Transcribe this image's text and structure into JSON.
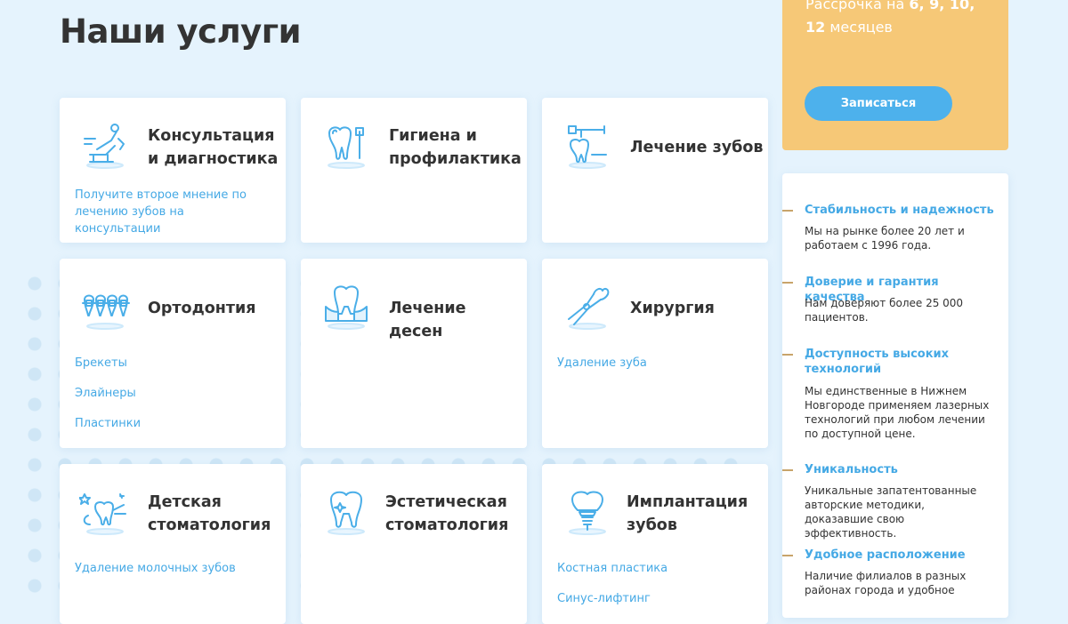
{
  "page": {
    "title": "Наши услуги"
  },
  "promo": {
    "line_prefix": "Рассрочка на",
    "months": "6, 9, 10, 12",
    "line_suffix": "месяцев",
    "button_label": "Записаться"
  },
  "services": [
    {
      "title": "Консультация и диагностика",
      "description": "Получите второе мнение по лечению зубов на консультации",
      "links": [],
      "icon": "dental-chair-icon"
    },
    {
      "title": "Гигиена и профилактика",
      "description": "",
      "links": [],
      "icon": "tooth-brush-icon"
    },
    {
      "title": "Лечение зубов",
      "description": "",
      "links": [],
      "icon": "tooth-drill-icon"
    },
    {
      "title": "Ортодонтия",
      "description": "",
      "links": [
        "Брекеты",
        "Элайнеры",
        "Пластинки"
      ],
      "icon": "braces-icon"
    },
    {
      "title": "Лечение десен",
      "description": "",
      "links": [],
      "icon": "gum-tooth-icon"
    },
    {
      "title": "Хирургия",
      "description": "",
      "links": [
        "Удаление зуба"
      ],
      "icon": "forceps-icon"
    },
    {
      "title": "Детская стоматология",
      "description": "",
      "links": [
        "Удаление молочных зубов"
      ],
      "icon": "tooth-fairy-icon"
    },
    {
      "title": "Эстетическая стоматология",
      "description": "",
      "links": [],
      "icon": "sparkle-tooth-icon"
    },
    {
      "title": "Имплантация зубов",
      "description": "",
      "links": [
        "Костная пластика",
        "Синус-лифтинг"
      ],
      "icon": "implant-icon"
    }
  ],
  "advantages": [
    {
      "title": "Стабильность и надежность",
      "text": "Мы на рынке более 20 лет и работаем с 1996 года."
    },
    {
      "title": "Доверие и гарантия качества",
      "text": "Нам доверяют более 25 000 пациентов."
    },
    {
      "title": "Доступность высоких технологий",
      "text": "Мы единственные в Нижнем Новгороде применяем лазерных технологий при любом лечении по доступной цене."
    },
    {
      "title": "Уникальность",
      "text": "Уникальные запатентованные авторские методики, доказавшие свою эффективность."
    },
    {
      "title": "Удобное расположение",
      "text": "Наличие филиалов в разных районах города и удобное"
    }
  ],
  "colors": {
    "accent": "#45a9e5",
    "promo_bg": "#f6c877",
    "button": "#4db1ec",
    "page_bg": "#e5f3fd"
  }
}
